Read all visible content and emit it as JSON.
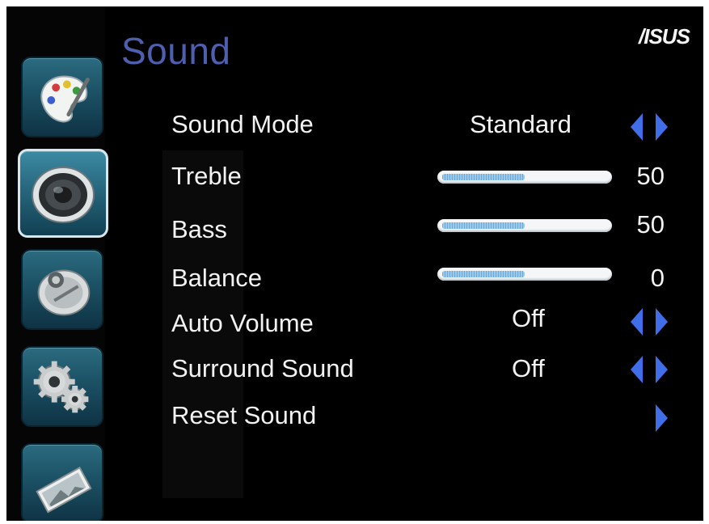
{
  "header": {
    "title": "Sound",
    "brand_logo": "/ISUS"
  },
  "sidebar": {
    "items": [
      {
        "name": "picture",
        "icon": "palette-icon",
        "active": false
      },
      {
        "name": "sound",
        "icon": "speaker-icon",
        "active": true
      },
      {
        "name": "channel",
        "icon": "satellite-dish-icon",
        "active": false
      },
      {
        "name": "setup",
        "icon": "gears-icon",
        "active": false
      },
      {
        "name": "media",
        "icon": "photo-icon",
        "active": false
      }
    ]
  },
  "menu": {
    "sound_mode": {
      "label": "Sound Mode",
      "value": "Standard"
    },
    "treble": {
      "label": "Treble",
      "value": "50",
      "level": 0.5
    },
    "bass": {
      "label": "Bass",
      "value": "50",
      "level": 0.5
    },
    "balance": {
      "label": "Balance",
      "value": "0",
      "level": 0.5
    },
    "auto_volume": {
      "label": "Auto Volume",
      "value": "Off"
    },
    "surround_sound": {
      "label": "Surround Sound",
      "value": "Off"
    },
    "reset_sound": {
      "label": "Reset Sound"
    }
  },
  "colors": {
    "title": "#4e5fb0",
    "arrow": "#3f6ee8",
    "slider_fill": "#6aaad8",
    "button": "#1d5367"
  }
}
